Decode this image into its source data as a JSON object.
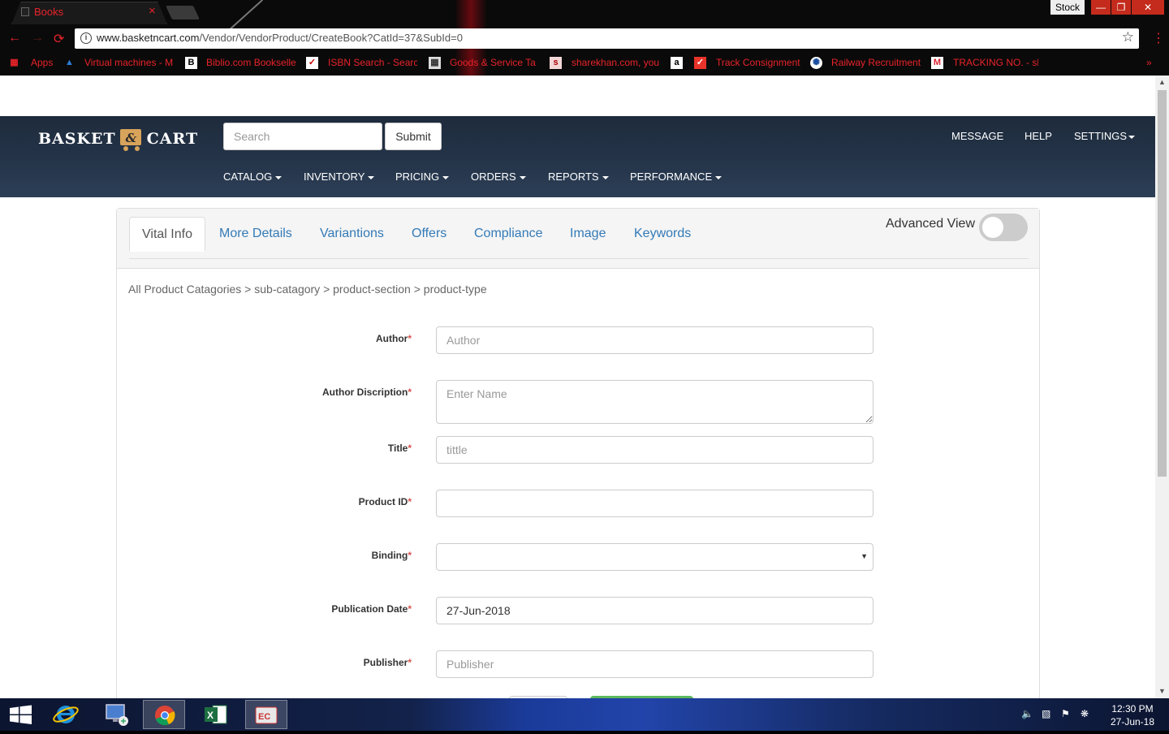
{
  "browser": {
    "tab_title": "Books",
    "tab_close": "×",
    "url_host": "www.basketncart.com",
    "url_path": "/Vendor/VendorProduct/CreateBook?CatId=37&SubId=0",
    "window_label": "Stock",
    "info_glyph": "i",
    "star_glyph": "☆",
    "menu_glyph": "⋮",
    "bookmarks": [
      {
        "icon": "apps-grid-icon",
        "label": "Apps"
      },
      {
        "icon": "azure-icon",
        "label": "Virtual machines - M"
      },
      {
        "icon": "biblio-icon",
        "label": "Biblio.com Bookselle"
      },
      {
        "icon": "isbn-icon",
        "label": "ISBN Search - Searc"
      },
      {
        "icon": "gst-icon",
        "label": "Goods & Service Ta"
      },
      {
        "icon": "sharekhan-icon",
        "label": "sharekhan.com, you"
      },
      {
        "icon": "amazon-icon",
        "label": ""
      },
      {
        "icon": "track-icon",
        "label": "Track Consignment"
      },
      {
        "icon": "railway-icon",
        "label": "Railway Recruitment"
      },
      {
        "icon": "gmail-icon",
        "label": "TRACKING NO. - sh"
      }
    ]
  },
  "site": {
    "logo_left": "BASKET",
    "logo_amp": "&",
    "logo_right": "CART",
    "search_placeholder": "Search",
    "submit_label": "Submit",
    "top_links": [
      "MESSAGE",
      "HELP",
      "SETTINGS"
    ],
    "menu": [
      "CATALOG",
      "INVENTORY",
      "PRICING",
      "ORDERS",
      "REPORTS",
      "PERFORMANCE"
    ]
  },
  "tabs": [
    "Vital Info",
    "More Details",
    "Variantions",
    "Offers",
    "Compliance",
    "Image",
    "Keywords"
  ],
  "advanced_view_label": "Advanced View",
  "breadcrumb": "All Product Catagories > sub-catagory > product-section > product-type",
  "form": {
    "required_mark": "*",
    "fields": [
      {
        "label": "Author",
        "placeholder": "Author",
        "value": ""
      },
      {
        "label": "Author Discription",
        "placeholder": "Enter Name",
        "value": ""
      },
      {
        "label": "Title",
        "placeholder": "tittle",
        "value": ""
      },
      {
        "label": "Product ID",
        "placeholder": "",
        "value": ""
      },
      {
        "label": "Binding",
        "placeholder": "",
        "value": ""
      },
      {
        "label": "Publication Date",
        "placeholder": "",
        "value": "27-Jun-2018"
      },
      {
        "label": "Publisher",
        "placeholder": "Publisher",
        "value": ""
      }
    ]
  },
  "taskbar": {
    "apps": [
      "windows-start-icon",
      "internet-explorer-icon",
      "remote-desktop-icon",
      "chrome-icon",
      "excel-icon",
      "ec-app-icon"
    ],
    "time": "12:30 PM",
    "date": "27-Jun-18"
  }
}
